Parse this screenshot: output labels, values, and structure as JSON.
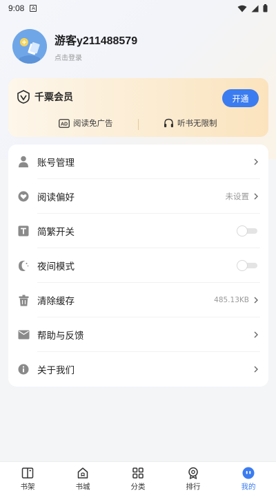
{
  "status_bar": {
    "time": "9:08",
    "notification_glyph": "A",
    "icons": [
      "wifi-icon",
      "signal-icon",
      "battery-icon"
    ]
  },
  "profile": {
    "username": "游客y211488579",
    "login_hint": "点击登录"
  },
  "vip": {
    "title": "千粟会员",
    "button": "开通",
    "benefits": [
      {
        "icon": "ad-icon",
        "label": "阅读免广告"
      },
      {
        "icon": "headphones-icon",
        "label": "听书无限制"
      }
    ]
  },
  "menu": {
    "items": [
      {
        "icon": "account-icon",
        "label": "账号管理",
        "value": "",
        "control": "chevron"
      },
      {
        "icon": "heart-icon",
        "label": "阅读偏好",
        "value": "未设置",
        "control": "chevron"
      },
      {
        "icon": "text-icon",
        "label": "简繁开关",
        "value": "",
        "control": "toggle",
        "on": false
      },
      {
        "icon": "moon-icon",
        "label": "夜间模式",
        "value": "",
        "control": "toggle",
        "on": false
      },
      {
        "icon": "trash-icon",
        "label": "清除缓存",
        "value": "485.13KB",
        "control": "chevron"
      },
      {
        "icon": "envelope-icon",
        "label": "帮助与反馈",
        "value": "",
        "control": "chevron"
      },
      {
        "icon": "info-icon",
        "label": "关于我们",
        "value": "",
        "control": "chevron"
      }
    ]
  },
  "tabs": [
    {
      "icon": "bookshelf-icon",
      "label": "书架",
      "active": false
    },
    {
      "icon": "store-icon",
      "label": "书城",
      "active": false
    },
    {
      "icon": "category-icon",
      "label": "分类",
      "active": false
    },
    {
      "icon": "ranking-icon",
      "label": "排行",
      "active": false
    },
    {
      "icon": "profile-icon",
      "label": "我的",
      "active": true
    }
  ],
  "colors": {
    "accent": "#3b7cf0",
    "vip_gold": "#fbe3bd",
    "background": "#f4f5f7",
    "icon_gray": "#8a8a8a"
  }
}
